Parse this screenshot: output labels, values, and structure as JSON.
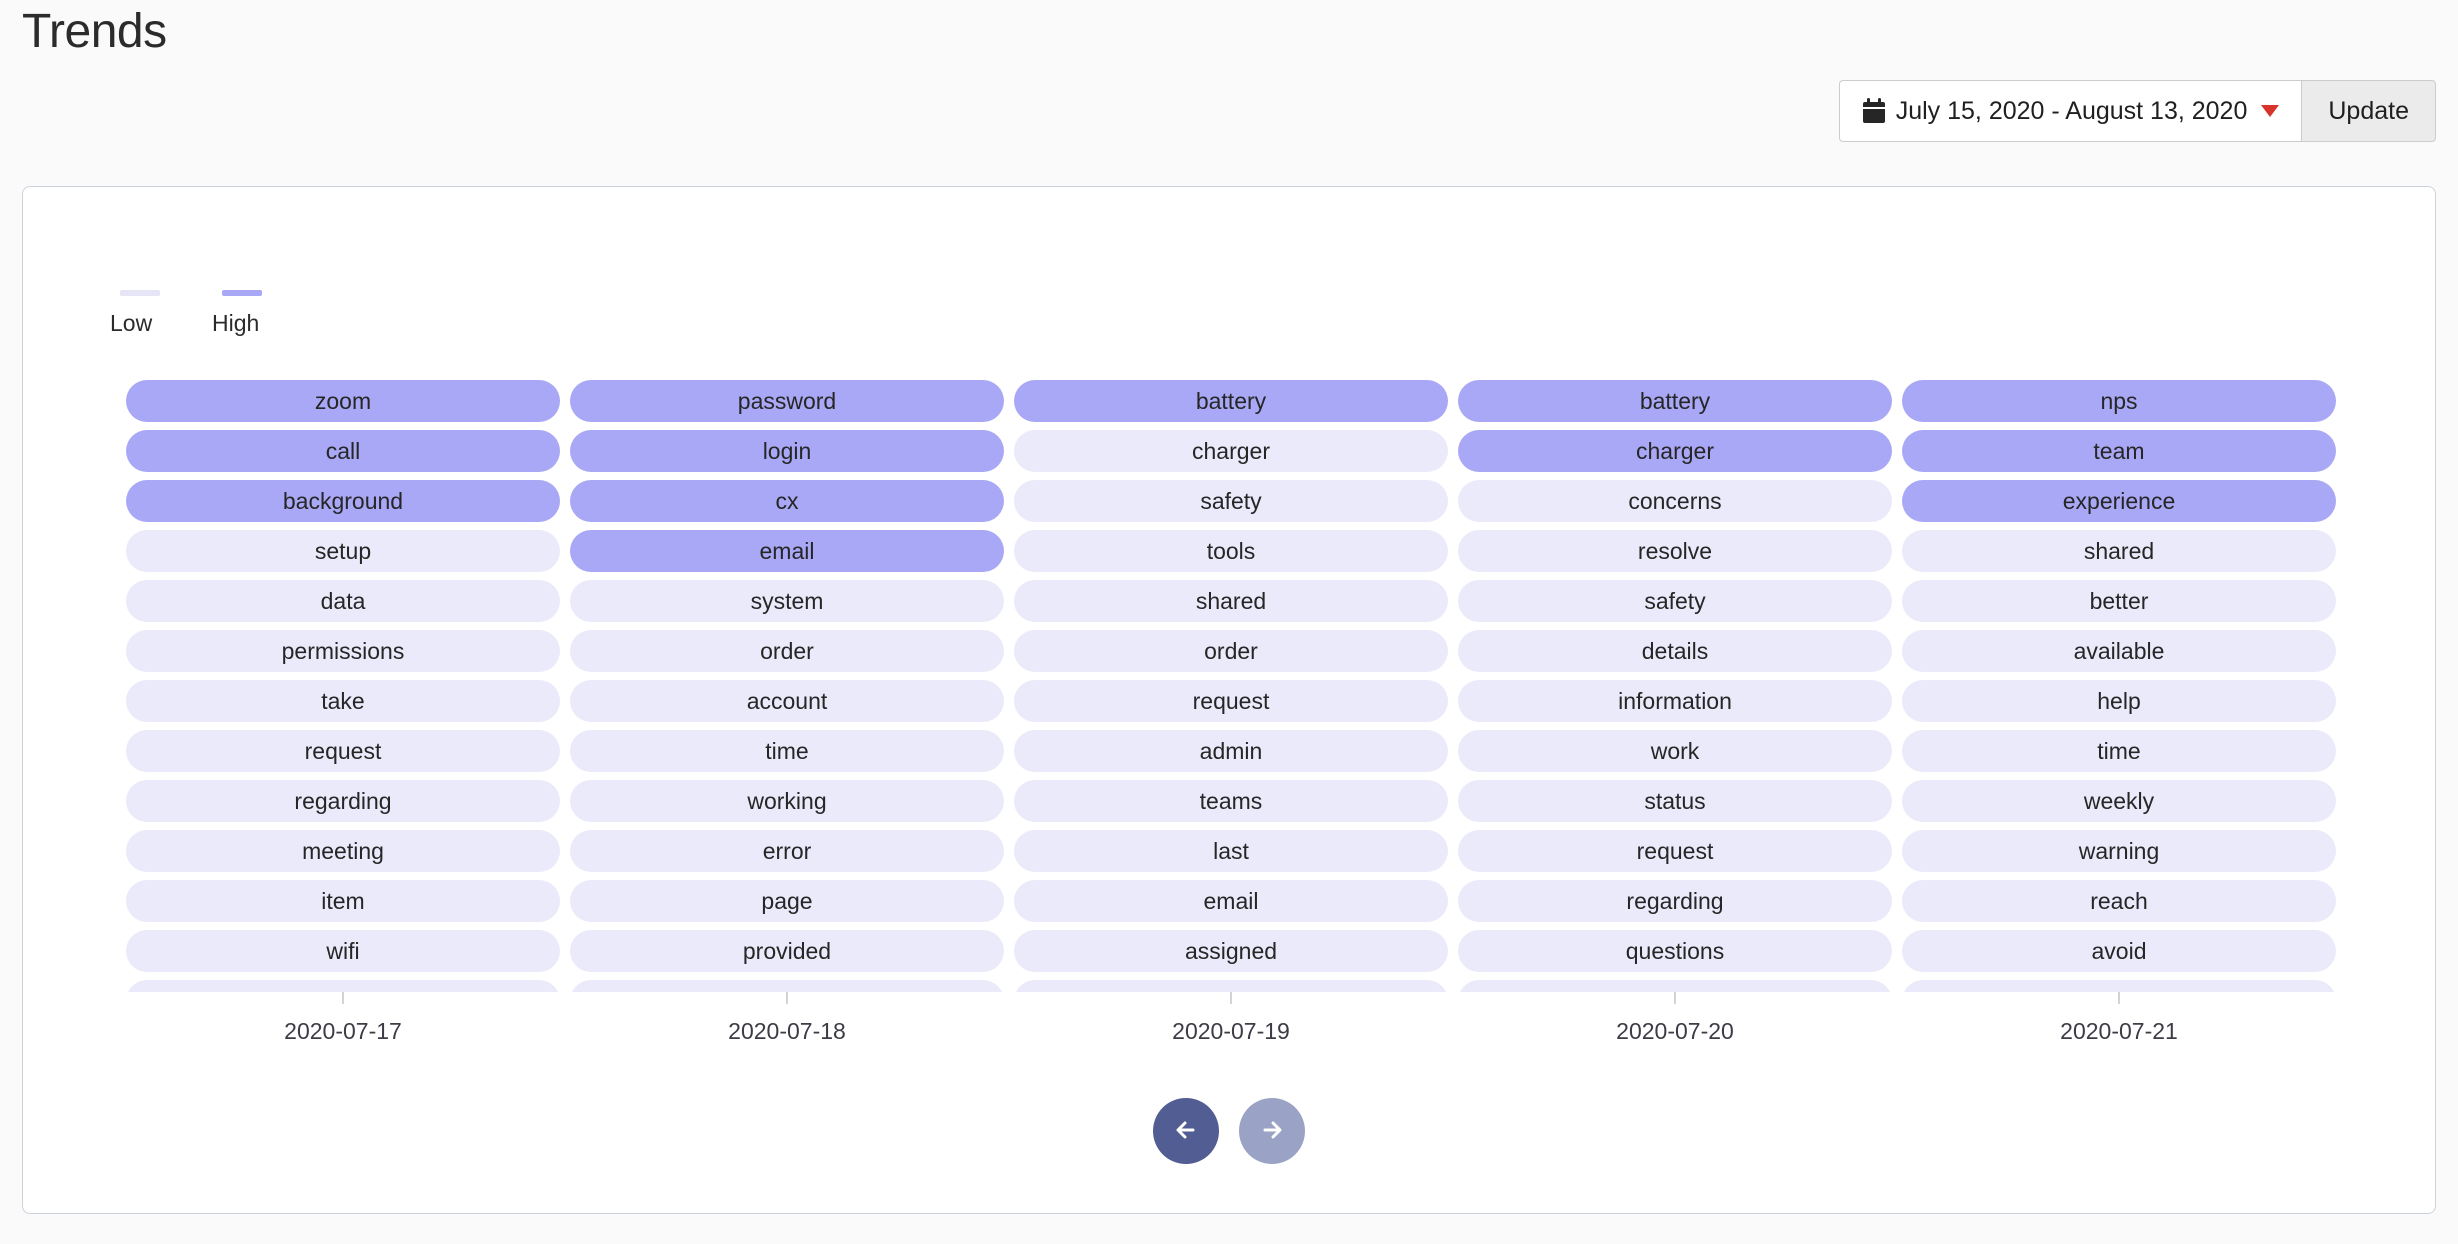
{
  "header": {
    "title": "Trends"
  },
  "toolbar": {
    "calendar_icon": "calendar-icon",
    "date_range": "July 15, 2020 - August 13, 2020",
    "caret_icon": "chevron-down-icon",
    "caret_color": "#d9342b",
    "update_label": "Update"
  },
  "legend": {
    "items": [
      {
        "label": "Low",
        "color": "#e6e5f6"
      },
      {
        "label": "High",
        "color": "#a9a8f6"
      }
    ]
  },
  "pagination": {
    "prev_icon": "arrow-left-icon",
    "next_icon": "arrow-right-icon",
    "prev_color": "#515d93",
    "next_color": "#9aa2c6"
  },
  "chart_data": {
    "type": "table",
    "title": "Trends",
    "xlabel": "",
    "ylabel": "",
    "grid": false,
    "legend_position": "top-left",
    "colors": {
      "low": "#ebeafb",
      "high": "#a9a8f6"
    },
    "categories": [
      "2020-07-17",
      "2020-07-18",
      "2020-07-19",
      "2020-07-20",
      "2020-07-21"
    ],
    "rank_count": 12,
    "series": [
      {
        "name": "2020-07-17",
        "values": [
          {
            "term": "zoom",
            "level": "high"
          },
          {
            "term": "call",
            "level": "high"
          },
          {
            "term": "background",
            "level": "high"
          },
          {
            "term": "setup",
            "level": "low"
          },
          {
            "term": "data",
            "level": "low"
          },
          {
            "term": "permissions",
            "level": "low"
          },
          {
            "term": "take",
            "level": "low"
          },
          {
            "term": "request",
            "level": "low"
          },
          {
            "term": "regarding",
            "level": "low"
          },
          {
            "term": "meeting",
            "level": "low"
          },
          {
            "term": "item",
            "level": "low"
          },
          {
            "term": "wifi",
            "level": "low"
          }
        ]
      },
      {
        "name": "2020-07-18",
        "values": [
          {
            "term": "password",
            "level": "high"
          },
          {
            "term": "login",
            "level": "high"
          },
          {
            "term": "cx",
            "level": "high"
          },
          {
            "term": "email",
            "level": "high"
          },
          {
            "term": "system",
            "level": "low"
          },
          {
            "term": "order",
            "level": "low"
          },
          {
            "term": "account",
            "level": "low"
          },
          {
            "term": "time",
            "level": "low"
          },
          {
            "term": "working",
            "level": "low"
          },
          {
            "term": "error",
            "level": "low"
          },
          {
            "term": "page",
            "level": "low"
          },
          {
            "term": "provided",
            "level": "low"
          }
        ]
      },
      {
        "name": "2020-07-19",
        "values": [
          {
            "term": "battery",
            "level": "high"
          },
          {
            "term": "charger",
            "level": "low"
          },
          {
            "term": "safety",
            "level": "low"
          },
          {
            "term": "tools",
            "level": "low"
          },
          {
            "term": "shared",
            "level": "low"
          },
          {
            "term": "order",
            "level": "low"
          },
          {
            "term": "request",
            "level": "low"
          },
          {
            "term": "admin",
            "level": "low"
          },
          {
            "term": "teams",
            "level": "low"
          },
          {
            "term": "last",
            "level": "low"
          },
          {
            "term": "email",
            "level": "low"
          },
          {
            "term": "assigned",
            "level": "low"
          }
        ]
      },
      {
        "name": "2020-07-20",
        "values": [
          {
            "term": "battery",
            "level": "high"
          },
          {
            "term": "charger",
            "level": "high"
          },
          {
            "term": "concerns",
            "level": "low"
          },
          {
            "term": "resolve",
            "level": "low"
          },
          {
            "term": "safety",
            "level": "low"
          },
          {
            "term": "details",
            "level": "low"
          },
          {
            "term": "information",
            "level": "low"
          },
          {
            "term": "work",
            "level": "low"
          },
          {
            "term": "status",
            "level": "low"
          },
          {
            "term": "request",
            "level": "low"
          },
          {
            "term": "regarding",
            "level": "low"
          },
          {
            "term": "questions",
            "level": "low"
          }
        ]
      },
      {
        "name": "2020-07-21",
        "values": [
          {
            "term": "nps",
            "level": "high"
          },
          {
            "term": "team",
            "level": "high"
          },
          {
            "term": "experience",
            "level": "high"
          },
          {
            "term": "shared",
            "level": "low"
          },
          {
            "term": "better",
            "level": "low"
          },
          {
            "term": "available",
            "level": "low"
          },
          {
            "term": "help",
            "level": "low"
          },
          {
            "term": "time",
            "level": "low"
          },
          {
            "term": "weekly",
            "level": "low"
          },
          {
            "term": "warning",
            "level": "low"
          },
          {
            "term": "reach",
            "level": "low"
          },
          {
            "term": "avoid",
            "level": "low"
          }
        ]
      }
    ]
  }
}
